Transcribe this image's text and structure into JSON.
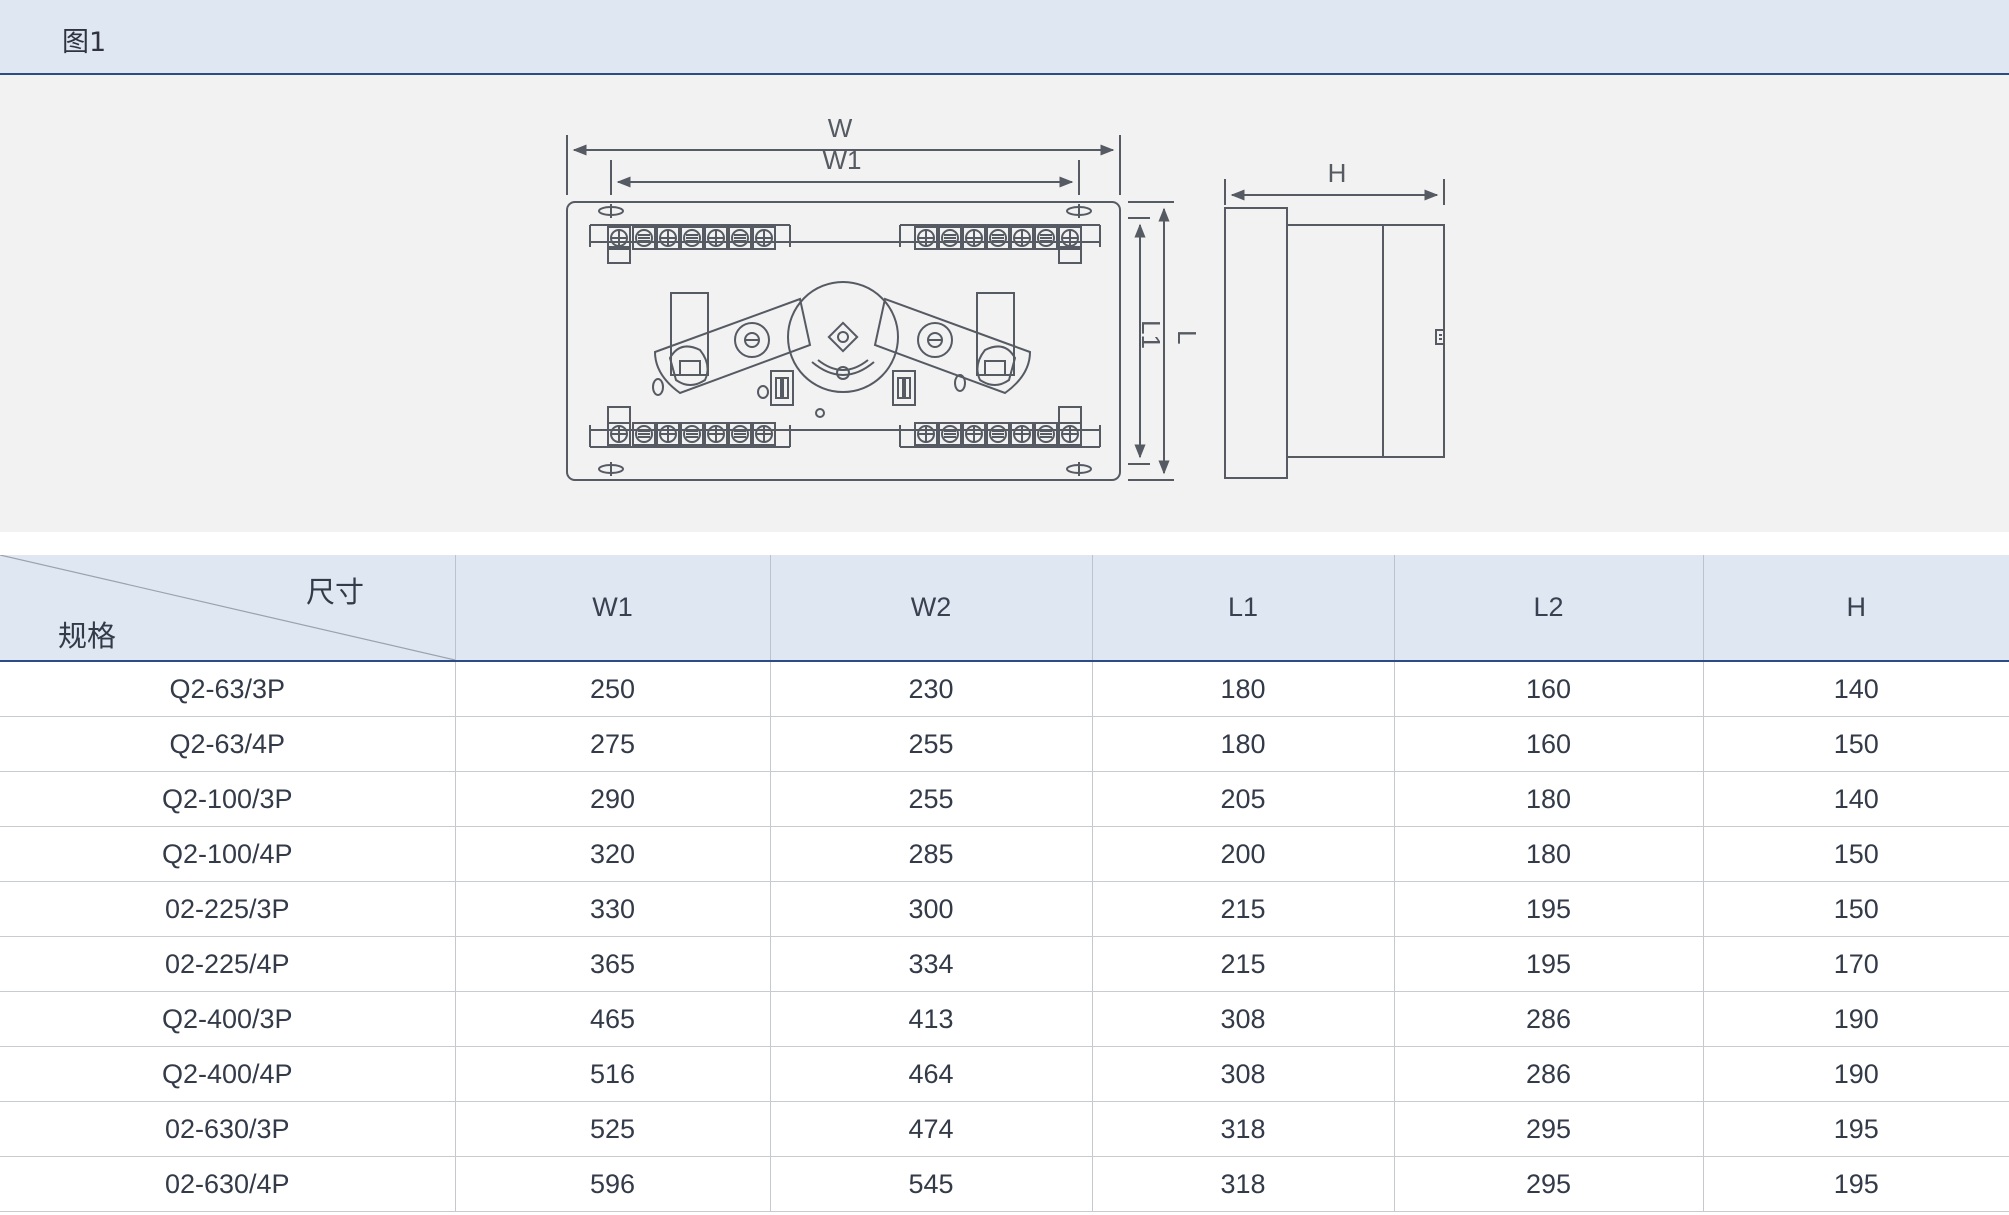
{
  "figure": {
    "caption": "图1"
  },
  "drawing": {
    "labels": {
      "w": "W",
      "w1": "W1",
      "l": "L",
      "l1": "L1",
      "h": "H"
    }
  },
  "table": {
    "corner": {
      "top_label": "尺寸",
      "bottom_label": "规格"
    },
    "headers": [
      "W1",
      "W2",
      "L1",
      "L2",
      "H"
    ],
    "rows": [
      [
        "Q2-63/3P",
        "250",
        "230",
        "180",
        "160",
        "140"
      ],
      [
        "Q2-63/4P",
        "275",
        "255",
        "180",
        "160",
        "150"
      ],
      [
        "Q2-100/3P",
        "290",
        "255",
        "205",
        "180",
        "140"
      ],
      [
        "Q2-100/4P",
        "320",
        "285",
        "200",
        "180",
        "150"
      ],
      [
        "02-225/3P",
        "330",
        "300",
        "215",
        "195",
        "150"
      ],
      [
        "02-225/4P",
        "365",
        "334",
        "215",
        "195",
        "170"
      ],
      [
        "Q2-400/3P",
        "465",
        "413",
        "308",
        "286",
        "190"
      ],
      [
        "Q2-400/4P",
        "516",
        "464",
        "308",
        "286",
        "190"
      ],
      [
        "02-630/3P",
        "525",
        "474",
        "318",
        "295",
        "195"
      ],
      [
        "02-630/4P",
        "596",
        "545",
        "318",
        "295",
        "195"
      ]
    ]
  },
  "colors": {
    "header_bg": "#dfe7f3",
    "accent_line": "#2d4b86",
    "panel_bg": "#f2f2f2",
    "drawing_stroke": "#555a63"
  }
}
